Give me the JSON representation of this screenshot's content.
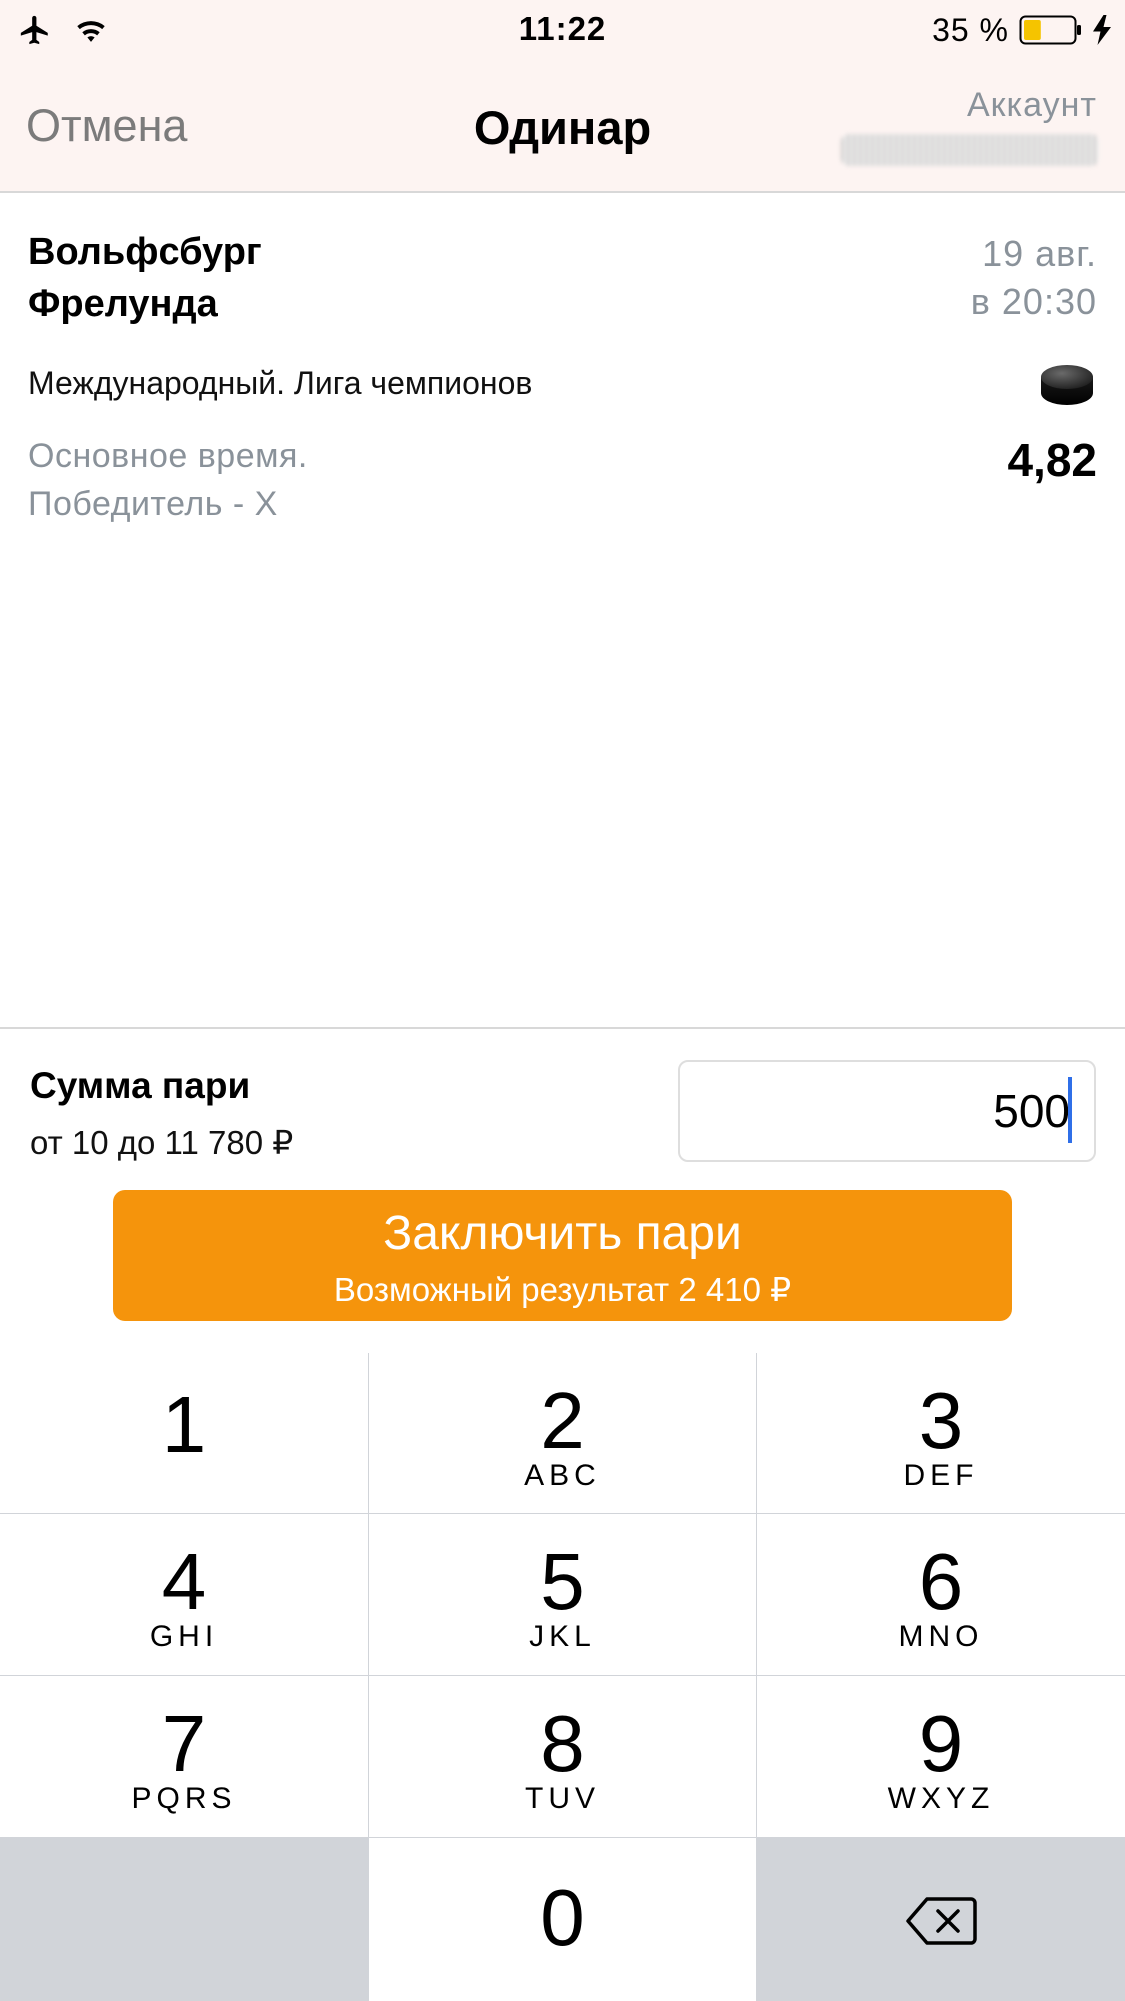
{
  "status_bar": {
    "time": "11:22",
    "battery_percent": "35 %",
    "battery_level": 0.35,
    "icons": [
      "airplane-icon",
      "wifi-icon",
      "battery-icon",
      "charging-bolt-icon"
    ]
  },
  "nav": {
    "cancel_label": "Отмена",
    "title": "Одинар",
    "account_label": "Аккаунт"
  },
  "event": {
    "team_home": "Вольфсбург",
    "team_away": "Фрелунда",
    "date": "19 авг.",
    "time": "в 20:30",
    "league": "Международный. Лига чемпионов",
    "sport_icon": "hockey-puck-icon",
    "market_line1": "Основное время.",
    "market_line2": "Победитель - X",
    "odds": "4,82"
  },
  "stake": {
    "title": "Сумма пари",
    "range": "от 10 до 11 780 ₽",
    "value": "500"
  },
  "place_bet": {
    "label": "Заключить пари",
    "possible_result": "Возможный результат 2 410 ₽",
    "color": "#f5940c"
  },
  "keypad": {
    "keys": [
      {
        "num": "1",
        "letters": ""
      },
      {
        "num": "2",
        "letters": "ABC"
      },
      {
        "num": "3",
        "letters": "DEF"
      },
      {
        "num": "4",
        "letters": "GHI"
      },
      {
        "num": "5",
        "letters": "JKL"
      },
      {
        "num": "6",
        "letters": "MNO"
      },
      {
        "num": "7",
        "letters": "PQRS"
      },
      {
        "num": "8",
        "letters": "TUV"
      },
      {
        "num": "9",
        "letters": "WXYZ"
      },
      {
        "num": "0",
        "letters": ""
      }
    ]
  }
}
